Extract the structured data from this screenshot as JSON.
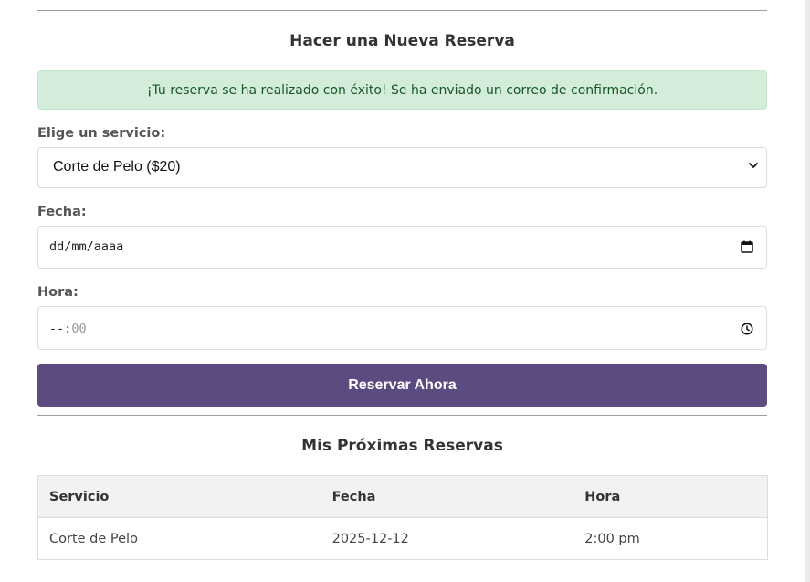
{
  "form": {
    "heading": "Hacer una Nueva Reserva",
    "success_message": "¡Tu reserva se ha realizado con éxito! Se ha enviado un correo de confirmación.",
    "service_label": "Elige un servicio:",
    "service_selected": "Corte de Pelo ($20)",
    "date_label": "Fecha:",
    "date_placeholder": "dd/mm/aaaa",
    "time_label": "Hora:",
    "time_placeholder_hours": "--",
    "time_placeholder_sep": ":",
    "time_placeholder_minutes": "00",
    "submit_label": "Reservar Ahora"
  },
  "bookings": {
    "heading": "Mis Próximas Reservas",
    "columns": [
      "Servicio",
      "Fecha",
      "Hora"
    ],
    "rows": [
      [
        "Corte de Pelo",
        "2025-12-12",
        "2:00 pm"
      ]
    ]
  },
  "colors": {
    "button": "#5c4b81",
    "alert_bg": "#d4edda",
    "alert_text": "#155724"
  },
  "icons": {
    "select": "chevron-down-icon",
    "date": "calendar-icon",
    "time": "clock-icon"
  }
}
